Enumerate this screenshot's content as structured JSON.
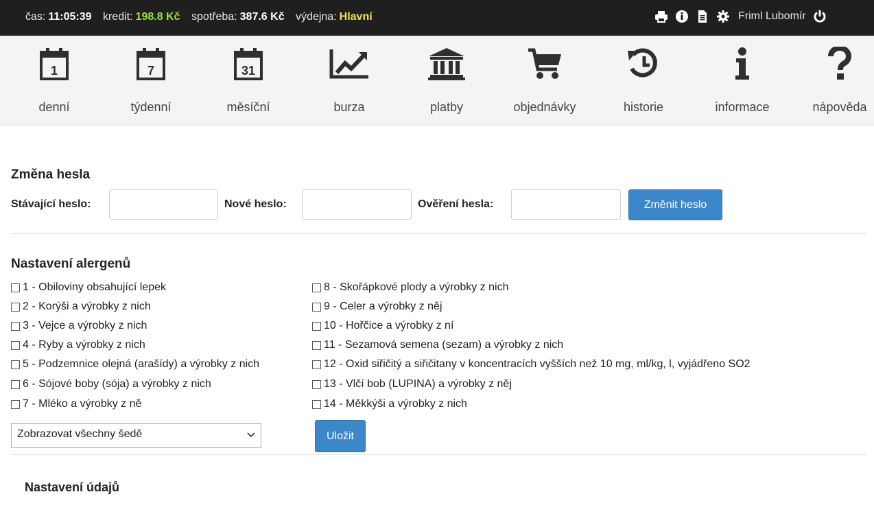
{
  "topbar": {
    "time_key": "čas:",
    "time_value": "11:05:39",
    "credit_key": "kredit:",
    "credit_value": "198.8 Kč",
    "spend_key": "spotřeba:",
    "spend_value": "387.6 Kč",
    "canteen_key": "výdejna:",
    "canteen_value": "Hlavní",
    "user_name": "Friml Lubomír",
    "icons": [
      "print-icon",
      "info-circle-icon",
      "document-icon",
      "gear-icon",
      "power-icon"
    ],
    "colors": {
      "background": "#1f1f1f",
      "credit": "#9be33a",
      "canteen": "#f3e24a"
    }
  },
  "nav": {
    "items": [
      {
        "label": "denní",
        "icon": "calendar-day-icon",
        "number": "1"
      },
      {
        "label": "týdenní",
        "icon": "calendar-week-icon",
        "number": "7"
      },
      {
        "label": "měsíční",
        "icon": "calendar-month-icon",
        "number": "31"
      },
      {
        "label": "burza",
        "icon": "chart-line-icon"
      },
      {
        "label": "platby",
        "icon": "bank-icon"
      },
      {
        "label": "objednávky",
        "icon": "cart-icon"
      },
      {
        "label": "historie",
        "icon": "history-icon"
      },
      {
        "label": "informace",
        "icon": "info-icon"
      },
      {
        "label": "nápověda",
        "icon": "question-icon"
      }
    ]
  },
  "password": {
    "title": "Změna hesla",
    "current_label": "Stávající heslo:",
    "new_label": "Nové heslo:",
    "confirm_label": "Ověření hesla:",
    "submit_label": "Změnit heslo"
  },
  "allergens": {
    "title": "Nastavení alergenů",
    "left": [
      "1 - Obiloviny obsahující lepek",
      "2 - Korýši a výrobky z nich",
      "3 - Vejce a výrobky z nich",
      "4 - Ryby a výrobky z nich",
      "5 - Podzemnice olejná (arašídy) a výrobky z nich",
      "6 - Sójové boby (sója) a výrobky z nich",
      "7 - Mléko a výrobky z ně"
    ],
    "right": [
      "8 - Skořápkové plody a výrobky z nich",
      "9 - Celer a výrobky z něj",
      "10 - Hořčice a výrobky z ní",
      "11 - Sezamová semena (sezam) a výrobky z nich",
      "12 - Oxid siřičitý a siřičitany v koncentracích vyšších než 10 mg, ml/kg, l, vyjádřeno SO2",
      "13 - Vlčí bob (LUPINA) a výrobky z něj",
      "14 - Měkkýši a výrobky z nich"
    ],
    "display_select_value": "Zobrazovat všechny šedě",
    "save_label": "Uložit"
  },
  "details": {
    "title": "Nastavení údajů"
  }
}
